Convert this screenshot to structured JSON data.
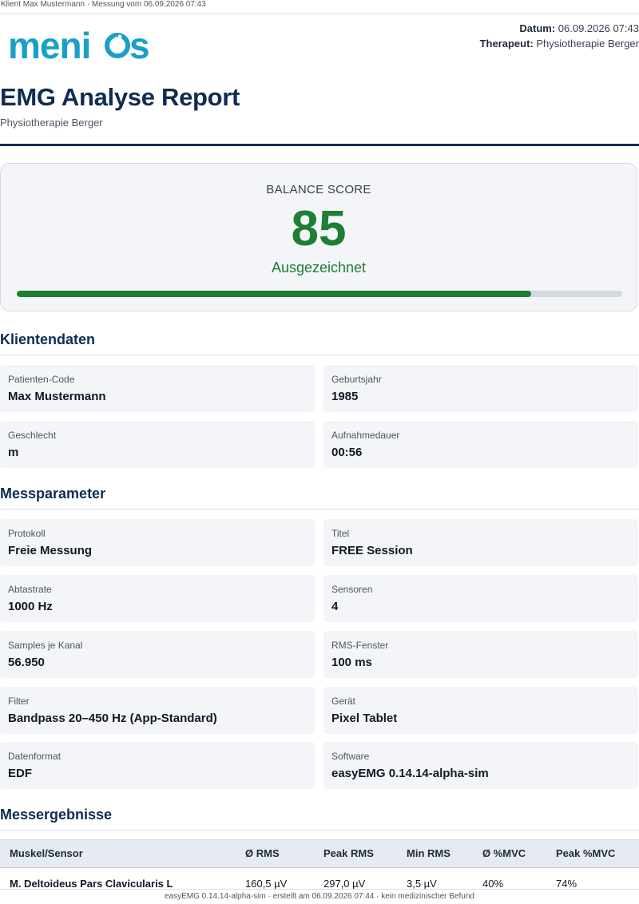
{
  "header_line": "Klient Max Mustermann · Messung vom 06.09.2026 07:43",
  "brand": {
    "logo_text": "menios",
    "primary_color": "#1c9fc7"
  },
  "meta": {
    "date_label": "Datum:",
    "date_value": "06.09.2026 07:43",
    "therapist_label": "Therapeut:",
    "therapist_value": "Physiotherapie Berger"
  },
  "title": "EMG Analyse Report",
  "subtitle": "Physiotherapie Berger",
  "score": {
    "label": "BALANCE SCORE",
    "value": "85",
    "rating": "Ausgezeichnet",
    "progress_fraction": 0.85,
    "color": "#1e7e34"
  },
  "client_section": {
    "heading": "Klientendaten",
    "fields": [
      {
        "label": "Patienten-Code",
        "value": "Max Mustermann"
      },
      {
        "label": "Geburtsjahr",
        "value": "1985"
      },
      {
        "label": "Geschlecht",
        "value": "m"
      },
      {
        "label": "Aufnahmedauer",
        "value": "00:56"
      }
    ]
  },
  "params_section": {
    "heading": "Messparameter",
    "fields": [
      {
        "label": "Protokoll",
        "value": "Freie Messung"
      },
      {
        "label": "Titel",
        "value": "FREE Session"
      },
      {
        "label": "Abtastrate",
        "value": "1000 Hz"
      },
      {
        "label": "Sensoren",
        "value": "4"
      },
      {
        "label": "Samples je Kanal",
        "value": "56.950"
      },
      {
        "label": "RMS-Fenster",
        "value": "100 ms"
      },
      {
        "label": "Filter",
        "value": "Bandpass 20–450 Hz (App-Standard)"
      },
      {
        "label": "Gerät",
        "value": "Pixel Tablet"
      },
      {
        "label": "Datenformat",
        "value": "EDF"
      },
      {
        "label": "Software",
        "value": "easyEMG 0.14.14-alpha-sim"
      }
    ]
  },
  "results_section": {
    "heading": "Messergebnisse",
    "columns": [
      "Muskel/Sensor",
      "Ø RMS",
      "Peak RMS",
      "Min RMS",
      "Ø %MVC",
      "Peak %MVC"
    ],
    "rows": [
      [
        "M. Deltoideus Pars Clavicularis L",
        "160,5 µV",
        "297,0 µV",
        "3,5 µV",
        "40%",
        "74%"
      ]
    ]
  },
  "footer": "easyEMG 0.14.14-alpha-sim · erstellt am 06.09.2026 07:44 · kein medizinischer Befund"
}
